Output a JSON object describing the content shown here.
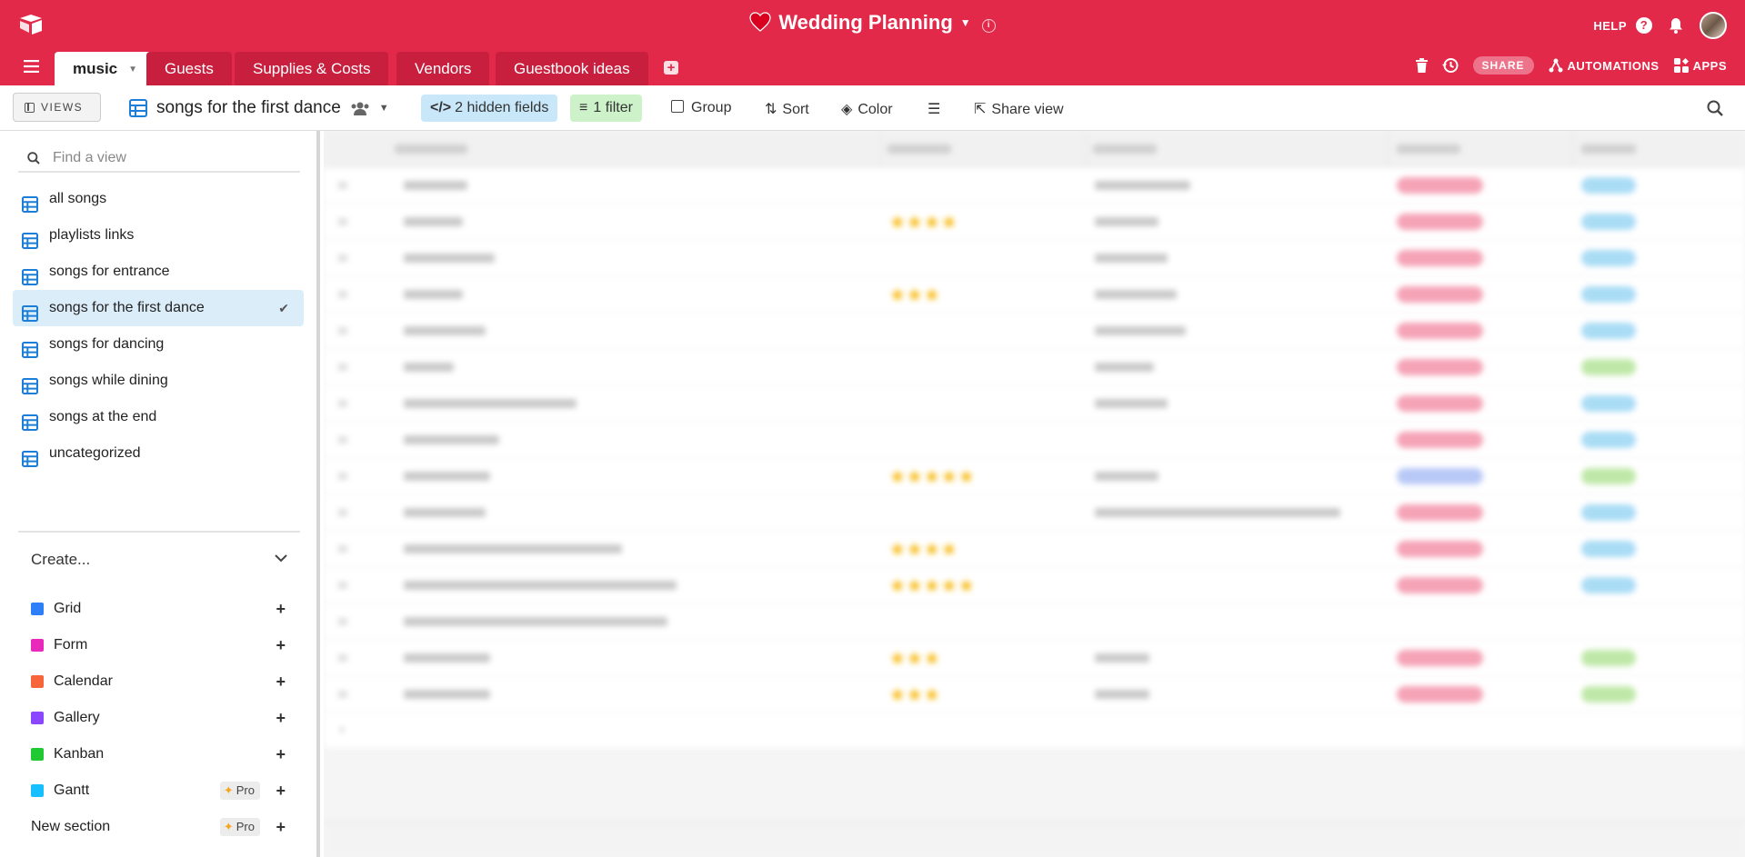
{
  "base": {
    "title": "Wedding Planning"
  },
  "topbar": {
    "help": "HELP"
  },
  "tabs": [
    {
      "label": "music",
      "active": true
    },
    {
      "label": "Guests"
    },
    {
      "label": "Supplies & Costs"
    },
    {
      "label": "Vendors"
    },
    {
      "label": "Guestbook ideas"
    }
  ],
  "tab_tools": {
    "share": "SHARE",
    "automations": "AUTOMATIONS",
    "apps": "APPS"
  },
  "viewbar": {
    "views_button": "VIEWS",
    "current_view": "songs for the first dance",
    "hidden_fields": "2 hidden fields",
    "filter": "1 filter",
    "group": "Group",
    "sort": "Sort",
    "color": "Color",
    "share_view": "Share view"
  },
  "sidebar": {
    "find_placeholder": "Find a view",
    "views": [
      {
        "label": "all songs"
      },
      {
        "label": "playlists links"
      },
      {
        "label": "songs for entrance"
      },
      {
        "label": "songs for the first dance",
        "selected": true
      },
      {
        "label": "songs for dancing"
      },
      {
        "label": "songs while dining"
      },
      {
        "label": "songs at the end"
      },
      {
        "label": "uncategorized"
      }
    ],
    "create_label": "Create...",
    "create_items": [
      {
        "label": "Grid",
        "color": "#2d7ff9"
      },
      {
        "label": "Form",
        "color": "#e929ba"
      },
      {
        "label": "Calendar",
        "color": "#f7653b"
      },
      {
        "label": "Gallery",
        "color": "#8b46ff"
      },
      {
        "label": "Kanban",
        "color": "#20c933"
      },
      {
        "label": "Gantt",
        "color": "#18bfff",
        "pro": "Pro"
      }
    ],
    "new_section": {
      "label": "New section",
      "pro": "Pro"
    }
  },
  "colors": {
    "brand": "#e2294a",
    "selected_view": "#dcedfa",
    "view_icon": "#1d7ed8",
    "star": "#f6b400"
  }
}
